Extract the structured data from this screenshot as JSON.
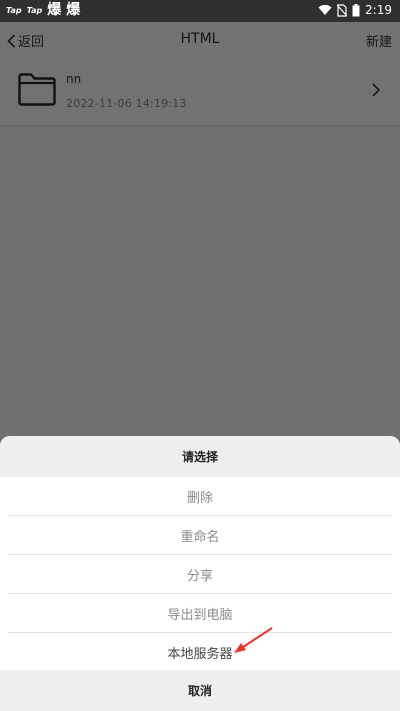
{
  "status_bar": {
    "left_logos": [
      "Tap",
      "Tap"
    ],
    "app_glyphs": [
      "爆",
      "爆"
    ],
    "time": "2:19"
  },
  "app_bar": {
    "back_label": "返回",
    "title": "HTML",
    "new_label": "新建"
  },
  "files": [
    {
      "name": "nn",
      "date": "2022-11-06 14:19:13",
      "icon": "folder-icon"
    }
  ],
  "sheet": {
    "title": "请选择",
    "items": [
      "删除",
      "重命名",
      "分享",
      "导出到电脑",
      "本地服务器"
    ],
    "cancel_label": "取消"
  },
  "colors": {
    "annotation_arrow": "#e8332a",
    "overlay": "#6f6f6f",
    "sheet_bg": "#ffffff"
  }
}
